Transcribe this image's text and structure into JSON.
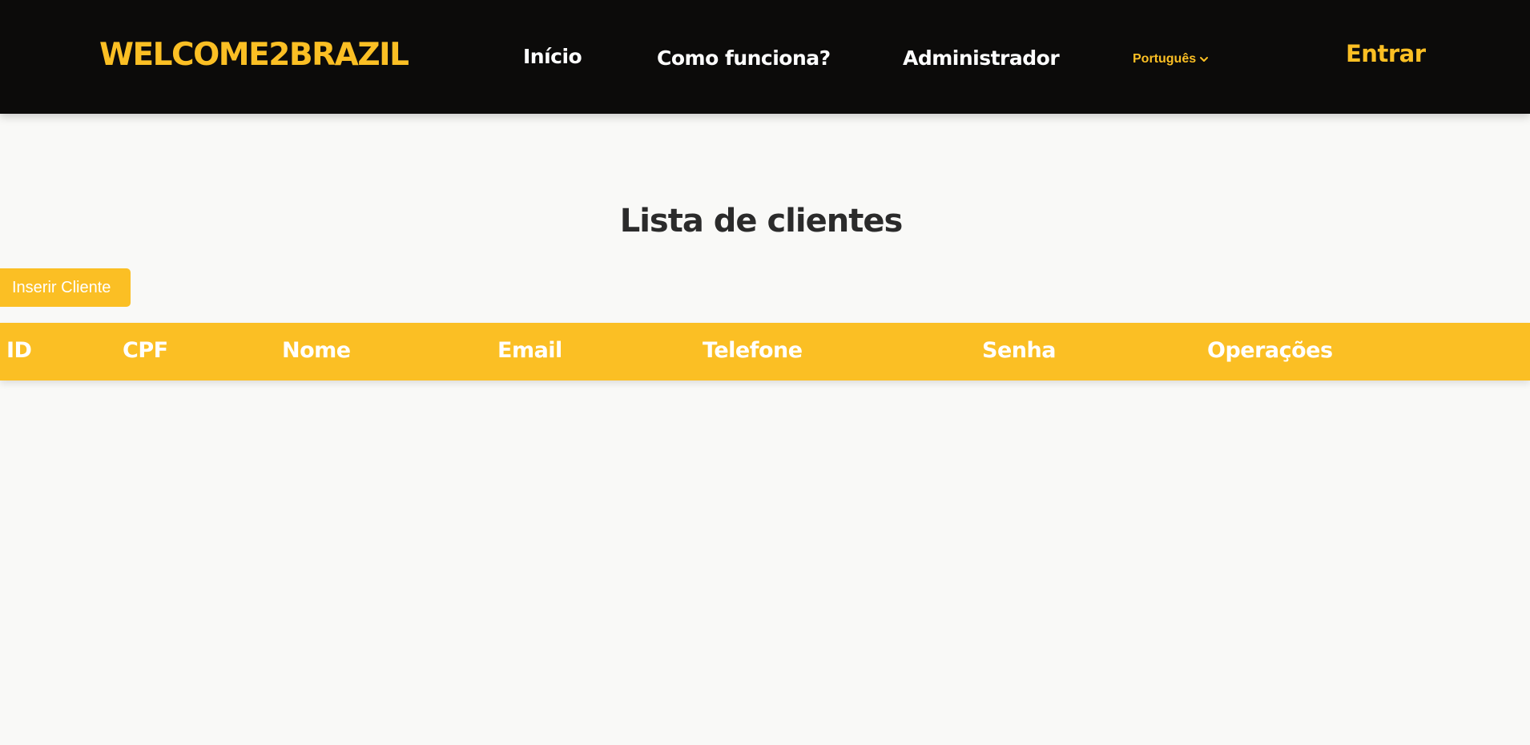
{
  "navbar": {
    "brand": "WELCOME2BRAZIL",
    "links": [
      {
        "label": "Início"
      },
      {
        "label": "Como funciona?"
      },
      {
        "label": "Administrador"
      }
    ],
    "language": {
      "selected": "Português",
      "icon": "chevron-down-icon"
    },
    "login_label": "Entrar"
  },
  "main": {
    "title": "Lista de clientes",
    "insert_button_label": "Inserir Cliente",
    "table": {
      "columns": [
        "ID",
        "CPF",
        "Nome",
        "Email",
        "Telefone",
        "Senha",
        "Operações"
      ],
      "rows": []
    }
  },
  "colors": {
    "accent": "#fbbf24",
    "navbar_bg": "#0c0b0a",
    "page_bg": "#f9f9f7",
    "title_text": "#2b2b2b"
  }
}
